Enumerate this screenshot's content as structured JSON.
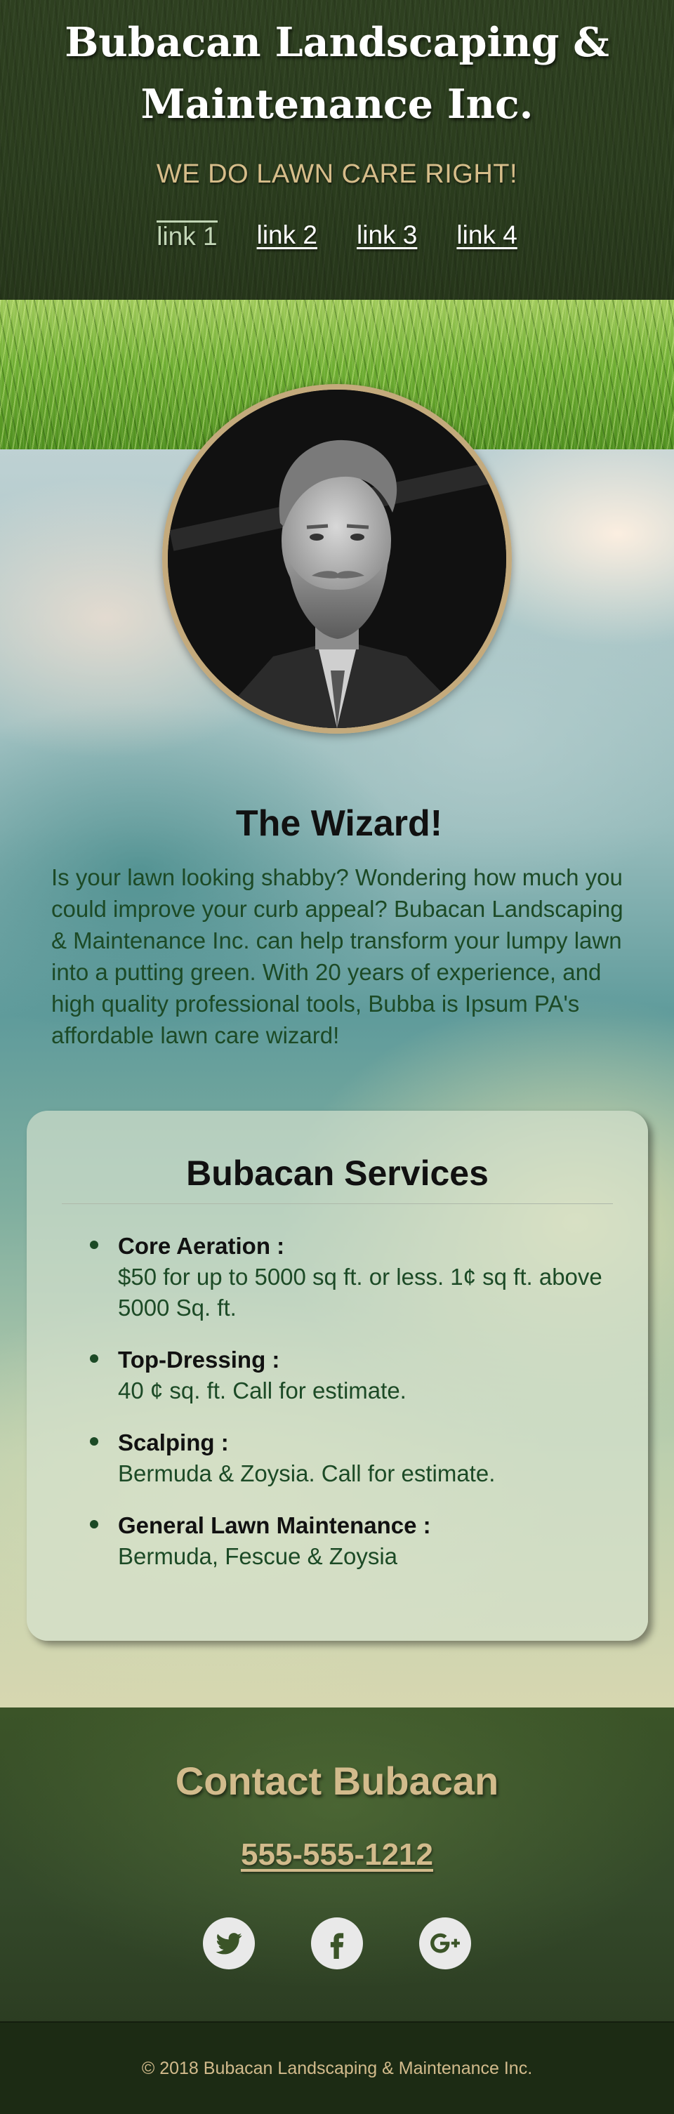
{
  "header": {
    "title_line1": "Bubacan Landscaping &",
    "title_line2": "Maintenance Inc.",
    "tagline": "WE DO LAWN CARE RIGHT!",
    "nav": [
      {
        "label": "link 1",
        "active": true
      },
      {
        "label": "link 2",
        "active": false
      },
      {
        "label": "link 3",
        "active": false
      },
      {
        "label": "link 4",
        "active": false
      }
    ]
  },
  "about": {
    "heading": "The Wizard!",
    "text": "Is your lawn looking shabby? Wondering how much you could improve your curb appeal? Bubacan Landscaping & Maintenance Inc. can help transform your lumpy lawn into a putting green. With 20 years of experience, and high quality professional tools, Bubba is Ipsum PA's affordable lawn care wizard!"
  },
  "services": {
    "heading": "Bubacan Services",
    "items": [
      {
        "name": "Core Aeration :",
        "desc": "$50 for up to 5000 sq ft. or less. 1¢ sq ft. above 5000 Sq. ft."
      },
      {
        "name": "Top-Dressing :",
        "desc": "40 ¢ sq. ft. Call for estimate."
      },
      {
        "name": "Scalping :",
        "desc": "Bermuda & Zoysia. Call for estimate."
      },
      {
        "name": "General Lawn Maintenance :",
        "desc": "Bermuda, Fescue & Zoysia"
      }
    ]
  },
  "contact": {
    "heading": "Contact Bubacan",
    "phone": "555-555-1212",
    "social": [
      "twitter-icon",
      "facebook-icon",
      "google-plus-icon"
    ]
  },
  "footer": {
    "copyright": "© 2018 Bubacan Landscaping & Maintenance Inc."
  },
  "colors": {
    "accent_gold": "#d2bb8c",
    "body_text_green": "#1c4a26",
    "dark_green": "#2b3d1e"
  }
}
